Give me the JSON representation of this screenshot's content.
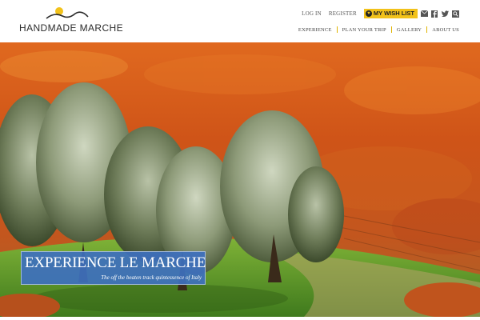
{
  "brand": {
    "name": "HANDMADE MARCHE",
    "logo_icon": "sun-over-hills-icon",
    "accent": "#f2c21a"
  },
  "topbar": {
    "login_label": "LOG IN",
    "register_label": "REGISTER",
    "wishlist_label": "MY WISH LIST",
    "social_icons": [
      "email-icon",
      "facebook-icon",
      "twitter-icon",
      "search-icon"
    ]
  },
  "nav": {
    "items": [
      {
        "label": "EXPERIENCE"
      },
      {
        "label": "PLAN YOUR TRIP"
      },
      {
        "label": "GALLERY"
      },
      {
        "label": "ABOUT US"
      }
    ]
  },
  "hero": {
    "title": "EXPERIENCE LE MARCHE",
    "subtitle": "The off the beaten track quintessence of Italy",
    "caption_color": "#3e70be"
  }
}
